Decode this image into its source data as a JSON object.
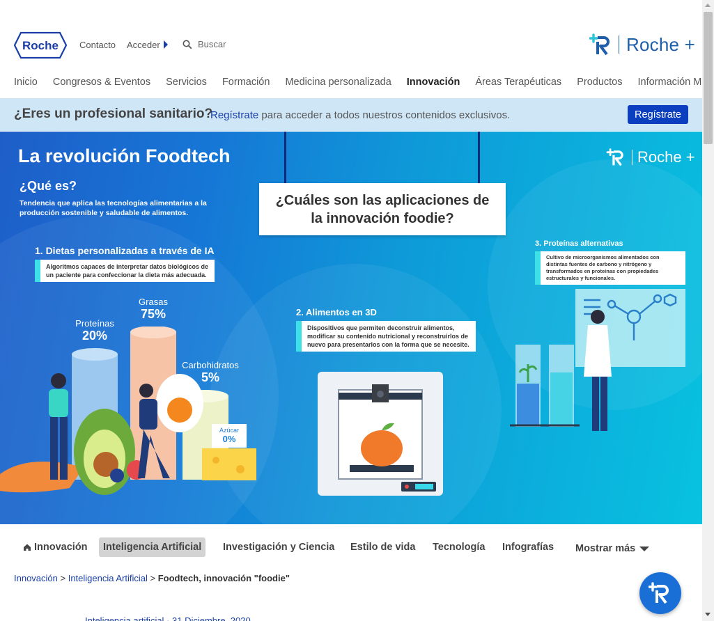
{
  "header": {
    "logo_text": "Roche",
    "contacto": "Contacto",
    "acceder": "Acceder",
    "search_placeholder": "Buscar",
    "brand_plus": "Roche +"
  },
  "nav": {
    "items": [
      {
        "label": "Inicio"
      },
      {
        "label": "Congresos & Eventos"
      },
      {
        "label": "Servicios"
      },
      {
        "label": "Formación"
      },
      {
        "label": "Medicina personalizada"
      },
      {
        "label": "Innovación"
      },
      {
        "label": "Áreas Terapéuticas"
      },
      {
        "label": "Productos"
      },
      {
        "label": "Información Médica"
      }
    ],
    "active_index": 5
  },
  "pro_banner": {
    "question": "¿Eres un profesional sanitario?",
    "link": "Regístrate",
    "text": " para acceder a todos nuestros contenidos exclusivos.",
    "button": "Regístrate"
  },
  "hero": {
    "title": "La revolución Foodtech",
    "que_es": "¿Qué es?",
    "definition": "Tendencia que aplica las tecnologías alimentarias a la producción sostenible y saludable de alimentos.",
    "brand": "Roche +",
    "question": "¿Cuáles son las aplicaciones de la innovación foodie?",
    "sec1_title": "1. Dietas personalizadas a través de IA",
    "sec1_text": "Algoritmos capaces de interpretar datos biológicos de un paciente para confeccionar la dieta más adecuada.",
    "sec2_title": "2. Alimentos en 3D",
    "sec2_text": "Dispositivos que permiten deconstruir alimentos, modificar su contenido nutricional y reconstruirlos de nuevo para presentarlos con la forma que se necesite.",
    "sec3_title": "3. Proteínas alternativas",
    "sec3_text": "Cultivo de microorganismos alimentados con distintas fuentes de carbono y nitrógeno y transformados en proteínas con propiedades estructurales y funcionales.",
    "bars": [
      {
        "name": "Proteínas",
        "pct": "20%"
      },
      {
        "name": "Grasas",
        "pct": "75%"
      },
      {
        "name": "Carbohidratos",
        "pct": "5%"
      },
      {
        "name": "Azúcar",
        "pct": "0%"
      }
    ]
  },
  "subnav": {
    "items": [
      "Innovación",
      "Inteligencia Artificial",
      "Investigación y Ciencia",
      "Estilo de vida",
      "Tecnología",
      "Infografías"
    ],
    "more": "Mostrar más",
    "active_index": 1
  },
  "breadcrumb": {
    "home": "Innovación",
    "sep1": " > ",
    "section": "Inteligencia Artificial",
    "sep2": " > ",
    "current": "Foodtech, innovación \"foodie\""
  },
  "meta": {
    "text": "Inteligencia artificial · 31 Diciembre, 2020"
  },
  "colors": {
    "brand_blue": "#1a3ea8",
    "button_blue": "#0b3fbf",
    "banner_bg": "#cfe6f7",
    "accent_cyan": "#3ee0e8"
  }
}
